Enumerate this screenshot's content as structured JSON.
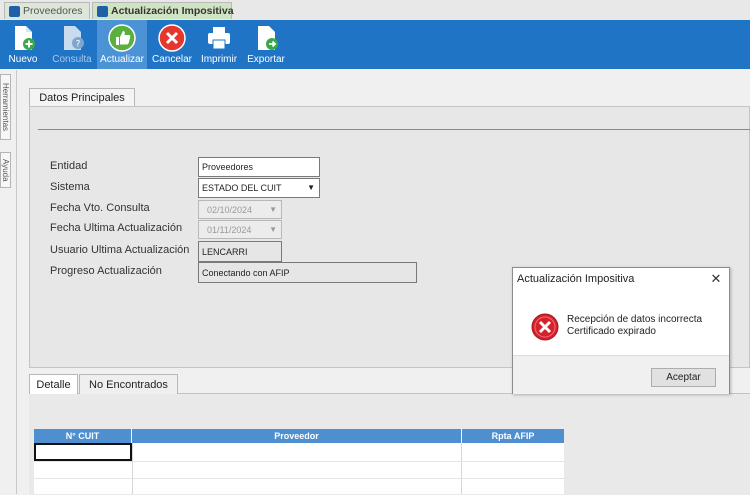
{
  "tabs": [
    {
      "label": "Proveedores"
    },
    {
      "label": "Actualización Impositiva"
    }
  ],
  "toolbar": {
    "nuevo": "Nuevo",
    "consulta": "Consulta",
    "actualizar": "Actualizar",
    "cancelar": "Cancelar",
    "imprimir": "Imprimir",
    "exportar": "Exportar"
  },
  "side_tabs": {
    "herramientas": "Herramientas",
    "ayuda": "Ayuda"
  },
  "main": {
    "tab_title": "Datos Principales",
    "fields": {
      "entidad": {
        "label": "Entidad",
        "value": "Proveedores"
      },
      "sistema": {
        "label": "Sistema",
        "value": "ESTADO DEL CUIT"
      },
      "fecha_vto": {
        "label": "Fecha Vto. Consulta",
        "value": "02/10/2024"
      },
      "fecha_ult": {
        "label": "Fecha Ultima Actualización",
        "value": "01/11/2024"
      },
      "usuario": {
        "label": "Usuario Ultima Actualización",
        "value": "LENCARRI"
      },
      "progreso": {
        "label": "Progreso Actualización",
        "value": "Conectando con AFIP"
      }
    }
  },
  "detail": {
    "tabs": [
      "Detalle",
      "No Encontrados"
    ],
    "columns": [
      "N° CUIT",
      "Proveedor",
      "Rpta AFIP"
    ]
  },
  "dialog": {
    "title": "Actualización Impositiva",
    "close": "✕",
    "message_line1": "Recepción de datos incorrecta",
    "message_line2": "Certificado expirado",
    "accept": "Aceptar"
  },
  "colors": {
    "toolbar": "#1f74c6",
    "selected_tool": "#4c93d6",
    "header": "#4f8fd0",
    "error": "#d8202a"
  }
}
